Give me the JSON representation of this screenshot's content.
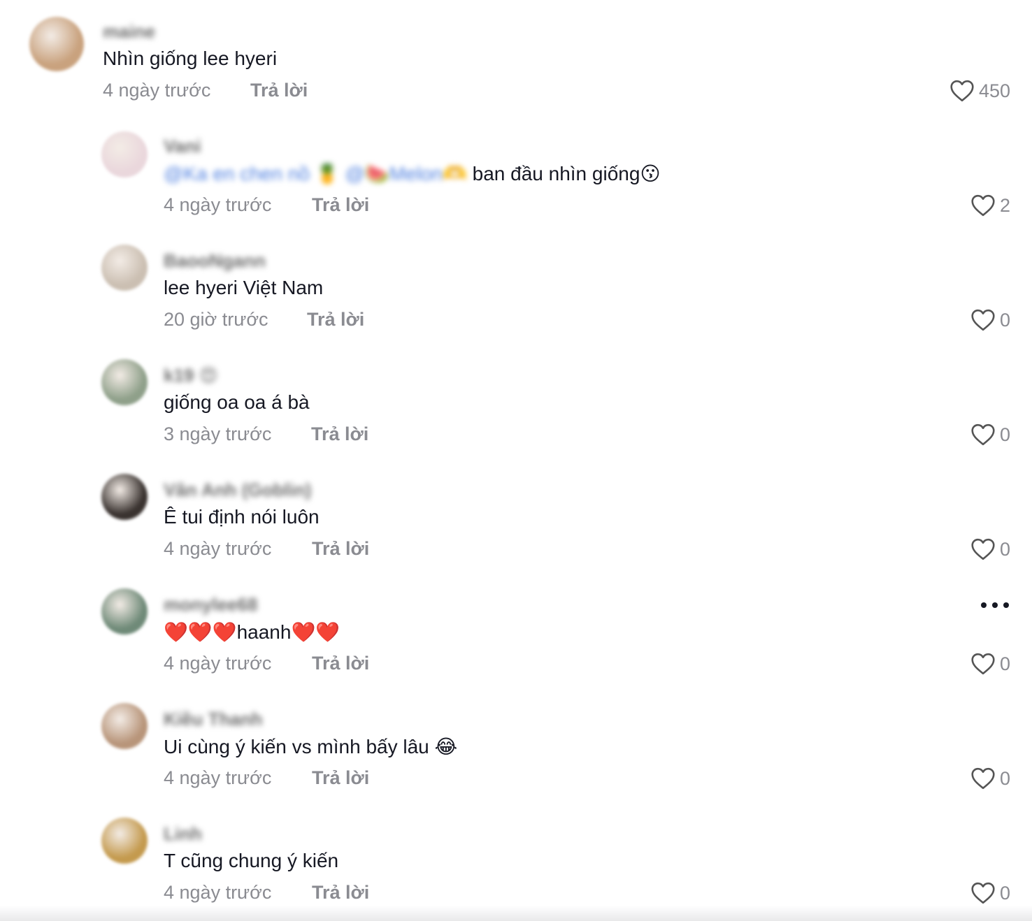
{
  "comments": [
    {
      "username": "maine",
      "text": "Nhìn giống lee hyeri",
      "time": "4 ngày trước",
      "reply": "Trả lời",
      "likes": "450",
      "avatar_color": "#c9a27e",
      "level": "top"
    },
    {
      "username": "Vani",
      "mentions": "@Ka en chen nồ 🍍 @🍉Melon🫶",
      "text": "ban đầu nhìn giống😗",
      "time": "4 ngày trước",
      "reply": "Trả lời",
      "likes": "2",
      "avatar_color": "#ead7dc",
      "level": "reply"
    },
    {
      "username": "BaooNgann",
      "text": "lee hyeri Việt Nam",
      "time": "20 giờ trước",
      "reply": "Trả lời",
      "likes": "0",
      "avatar_color": "#cbbfb2",
      "level": "reply"
    },
    {
      "username": "k19 😍",
      "text": "giống oa oa á bà",
      "time": "3 ngày trước",
      "reply": "Trả lời",
      "likes": "0",
      "avatar_color": "#8fa08a",
      "level": "reply"
    },
    {
      "username": "Vân Anh (Goblin)",
      "text": "Ê tui định nói luôn",
      "time": "4 ngày trước",
      "reply": "Trả lời",
      "likes": "0",
      "avatar_color": "#3a3330",
      "level": "reply"
    },
    {
      "username": "monylee68",
      "text": "❤️❤️❤️haanh❤️❤️",
      "time": "4 ngày trước",
      "reply": "Trả lời",
      "likes": "0",
      "avatar_color": "#6f8a78",
      "level": "reply"
    },
    {
      "username": "Kiều Thanh",
      "text": "Ui cùng ý kiến vs mình bấy lâu 😂",
      "time": "4 ngày trước",
      "reply": "Trả lời",
      "likes": "0",
      "avatar_color": "#b8957a",
      "level": "reply"
    },
    {
      "username": "Linh",
      "text": "T cũng chung ý kiến",
      "time": "4 ngày trước",
      "reply": "Trả lời",
      "likes": "0",
      "avatar_color": "#c49a4e",
      "level": "reply"
    }
  ],
  "icons": {
    "like": "heart-outline-icon",
    "more": "more-horizontal-icon"
  }
}
